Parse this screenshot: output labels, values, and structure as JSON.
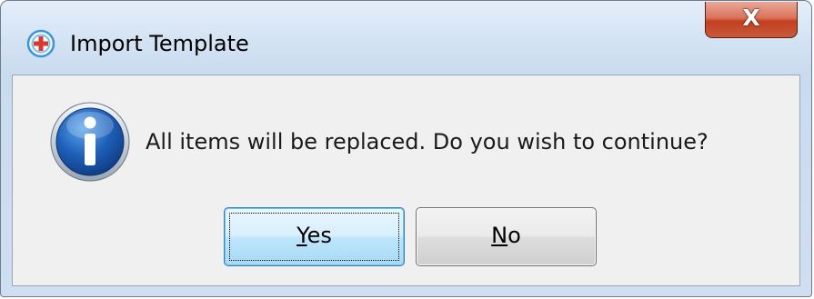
{
  "window": {
    "title": "Import Template",
    "close_label": "X"
  },
  "icons": {
    "app_icon": "template-app-icon",
    "message_icon": "information-icon"
  },
  "dialog": {
    "message": "All items will be replaced. Do you wish to continue?"
  },
  "buttons": {
    "yes": {
      "mnemonic": "Y",
      "rest": "es",
      "focused": true
    },
    "no": {
      "mnemonic": "N",
      "rest": "o",
      "focused": false
    }
  },
  "colors": {
    "titlebar": "#d5e4f4",
    "client": "#f0f0f0",
    "close_button": "#c4401f",
    "default_button": "#bee6fd",
    "info_icon": "#1d5fb8"
  }
}
